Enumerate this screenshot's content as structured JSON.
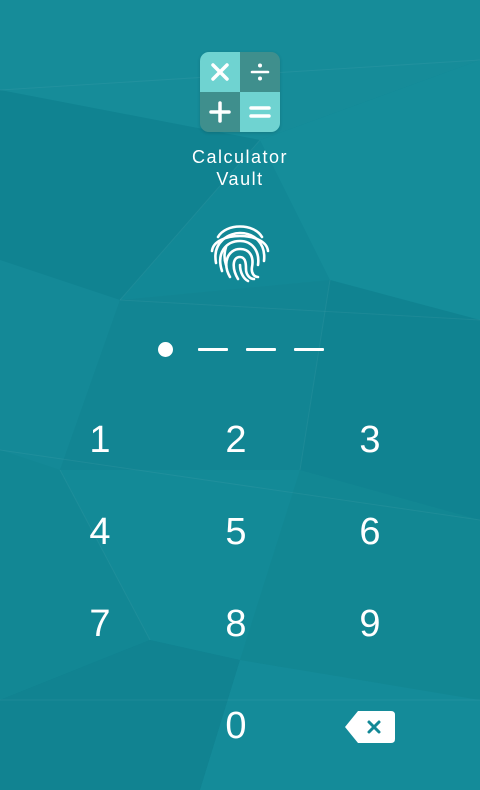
{
  "app": {
    "name_line1": "Calculator",
    "name_line2": "Vault"
  },
  "logo": {
    "symbols": [
      "×",
      "÷",
      "+",
      "="
    ],
    "colors": {
      "light": "#6fd3d1",
      "dark": "#3f8f8d"
    }
  },
  "pin": {
    "length": 4,
    "entered": 1
  },
  "keypad": {
    "keys": [
      "1",
      "2",
      "3",
      "4",
      "5",
      "6",
      "7",
      "8",
      "9",
      "0"
    ],
    "backspace_icon": "backspace-icon"
  },
  "icons": {
    "fingerprint": "fingerprint-icon"
  },
  "colors": {
    "background": "#128896",
    "foreground": "#ffffff"
  }
}
